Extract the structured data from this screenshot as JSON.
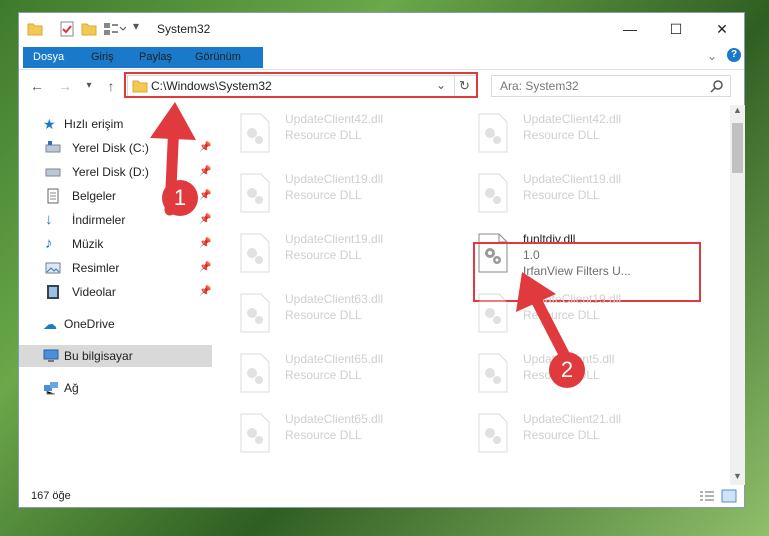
{
  "window": {
    "title": "System32",
    "minimize": "—",
    "maximize": "☐",
    "close": "✕"
  },
  "ribbon": {
    "tabs": [
      "Dosya",
      "Giriş",
      "Paylaş",
      "Görünüm"
    ]
  },
  "address": {
    "path": "C:\\Windows\\System32",
    "search_placeholder": "Ara: System32"
  },
  "nav": {
    "quick_access": "Hızlı erişim",
    "items": [
      "Yerel Disk (C:)",
      "Yerel Disk (D:)",
      "Belgeler",
      "İndirmeler",
      "Müzik",
      "Resimler",
      "Videolar"
    ],
    "onedrive": "OneDrive",
    "this_pc": "Bu bilgisayar",
    "network": "Ağ"
  },
  "files": {
    "left": [
      {
        "name": "UpdateClient42.dll",
        "type": "Resource DLL"
      },
      {
        "name": "UpdateClient19.dll",
        "type": "Resource DLL"
      },
      {
        "name": "UpdateClient19.dll",
        "type": "Resource DLL"
      },
      {
        "name": "UpdateClient63.dll",
        "type": "Resource DLL"
      },
      {
        "name": "UpdateClient65.dll",
        "type": "Resource DLL"
      },
      {
        "name": "UpdateClient65.dll",
        "type": "Resource DLL"
      }
    ],
    "right": [
      {
        "name": "UpdateClient42.dll",
        "type": "Resource DLL"
      },
      {
        "name": "UpdateClient19.dll",
        "type": "Resource DLL"
      },
      {
        "name": "funltdiv.dll",
        "type": "1.0",
        "desc": "IrfanView Filters U..."
      },
      {
        "name": "UpdateClient19.dll",
        "type": "Resource DLL"
      },
      {
        "name": "UpdateClient5.dll",
        "type": "Resource DLL"
      },
      {
        "name": "UpdateClient21.dll",
        "type": "Resource DLL"
      }
    ]
  },
  "status": {
    "count": "167 öğe"
  },
  "annotations": {
    "step1": "1",
    "step2": "2"
  },
  "colors": {
    "accent": "#1979ca",
    "highlight": "#e0393e"
  }
}
